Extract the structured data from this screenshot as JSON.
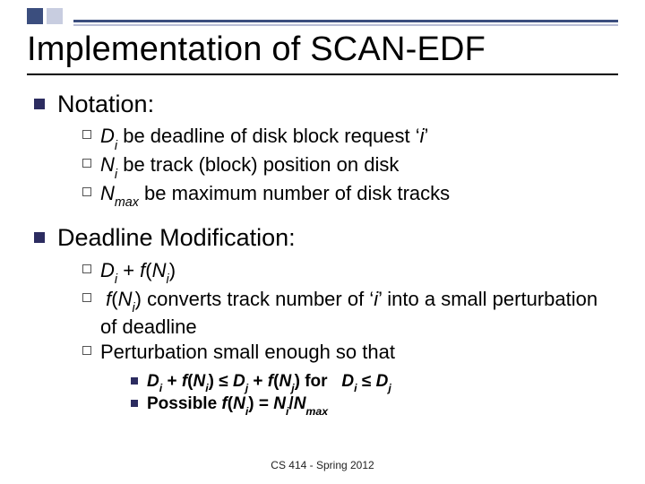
{
  "title": "Implementation of SCAN-EDF",
  "footer": "CS 414 - Spring 2012",
  "sections": [
    {
      "heading": "Notation:",
      "items": [
        {
          "var": "D",
          "sub": "i",
          "mid": " be deadline of disk block request ",
          "ivar": "i"
        },
        {
          "var": "N",
          "sub": "i",
          "rest": " be track (block) position on disk"
        },
        {
          "var": "N",
          "sub": "max",
          "rest": " be maximum number of disk tracks"
        }
      ]
    },
    {
      "heading": "Deadline Modification:",
      "items": [
        {
          "formula": "D_i + f(N_i)"
        },
        {
          "mid": " converts track number of ",
          "ivar": "i",
          "tail": "  into a small perturbation of deadline"
        },
        {
          "text": "Perturbation small enough so that"
        }
      ],
      "subitems": [
        {
          "formula": "D_i + f(N_i) ≤ D_j + f(N_j) for D_i ≤ D_j",
          "mid": " for "
        },
        {
          "lead": "Possible ",
          "formula": "f(N_i) = N_i / N_max"
        }
      ]
    }
  ]
}
